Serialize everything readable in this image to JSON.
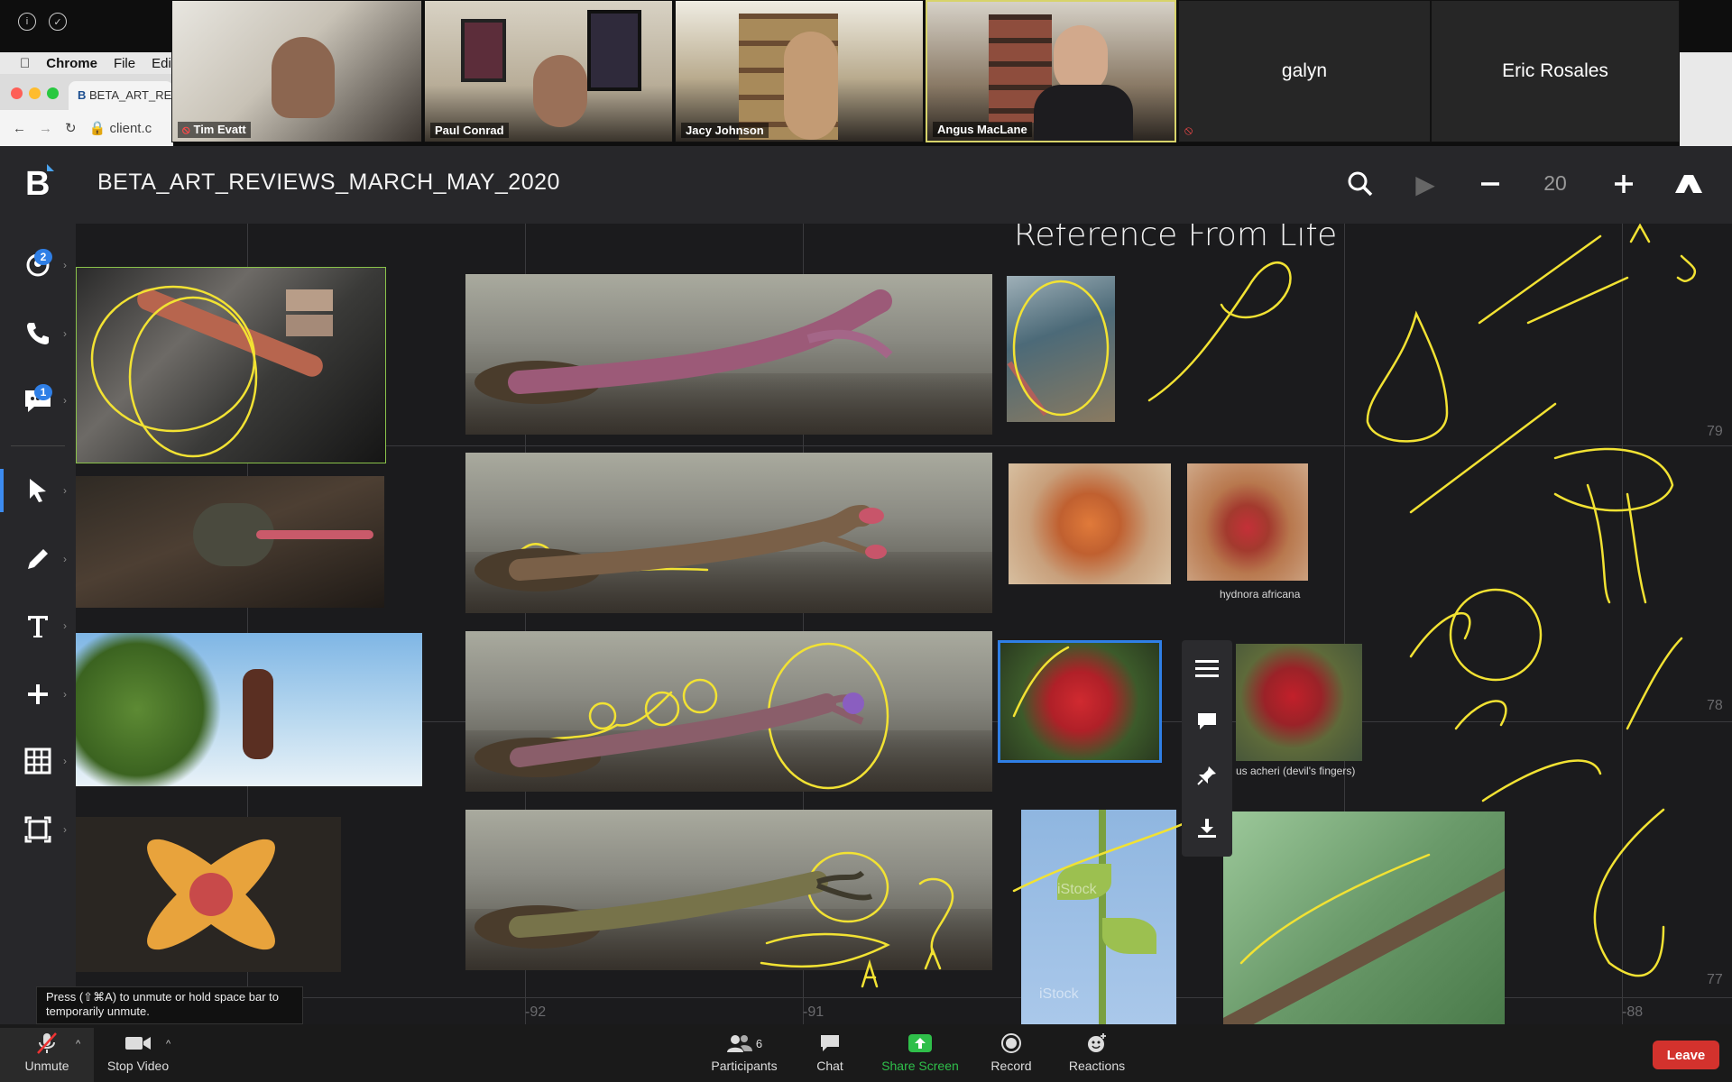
{
  "zoom_top": {
    "participants": [
      {
        "name": "Tim Evatt",
        "muted": true
      },
      {
        "name": "Paul Conrad",
        "muted": false
      },
      {
        "name": "Jacy Johnson",
        "muted": false
      },
      {
        "name": "Angus MacLane",
        "muted": false,
        "active": true
      },
      {
        "name": "galyn",
        "video": false
      },
      {
        "name": "Eric Rosales",
        "video": false
      }
    ]
  },
  "mac_menu": {
    "app": "Chrome",
    "file": "File",
    "edit": "Edi"
  },
  "chrome": {
    "tab_title": "BETA_ART_RE",
    "address": "client.c"
  },
  "app": {
    "board_title": "BETA_ART_REVIEWS_MARCH_MAY_2020",
    "zoom_level": "20",
    "chat_badge_count": "2",
    "message_badge_count": "1",
    "tools": [
      "cursor",
      "pen",
      "text",
      "add",
      "grid",
      "frame"
    ]
  },
  "canvas": {
    "reference_title": "Reference From Life",
    "captions": {
      "hydnora": "hydnora africana",
      "devils_fingers": "us acheri (devil's fingers)"
    },
    "coord_labels_x": [
      "-92",
      "-91",
      "-88"
    ],
    "coord_labels_y": [
      "79",
      "78",
      "77"
    ],
    "watermark": "iStock"
  },
  "tooltip": {
    "line1": "Press  (⇧⌘A) to unmute or hold space bar to",
    "line2": "temporarily unmute."
  },
  "zoom_bottom": {
    "unmute": "Unmute",
    "stop_video": "Stop Video",
    "participants": "Participants",
    "participants_count": "6",
    "chat": "Chat",
    "share_screen": "Share Screen",
    "record": "Record",
    "reactions": "Reactions",
    "leave": "Leave"
  },
  "colors": {
    "annotation": "#f2e233",
    "share_green": "#2fbf4a",
    "leave_red": "#d3322d",
    "accent_blue": "#2f7fe6"
  }
}
